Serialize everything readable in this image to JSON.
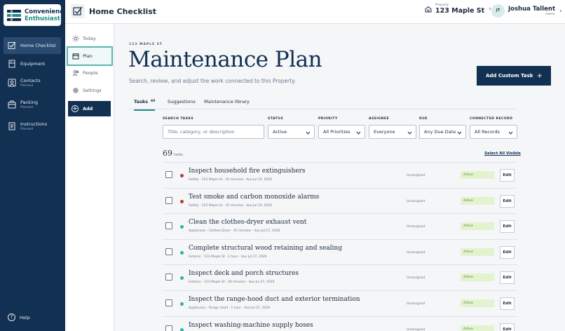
{
  "brand": {
    "line1": "Convenience",
    "line2": "Enthusiast"
  },
  "sidebar": {
    "items": [
      {
        "label": "Home Checklist",
        "sub": ""
      },
      {
        "label": "Equipment",
        "sub": ""
      },
      {
        "label": "Contacts",
        "sub": "Planned"
      },
      {
        "label": "Packing",
        "sub": "Planned"
      },
      {
        "label": "Instructions",
        "sub": "Planned"
      }
    ],
    "help": "Help"
  },
  "topbar": {
    "title": "Home Checklist",
    "property_label": "Property",
    "property_name": "123 Maple St",
    "user_initials": "JT",
    "user_name": "Joshua Tallent",
    "user_role": "owner"
  },
  "nav2": {
    "items": [
      "Today",
      "Plan",
      "People",
      "Settings"
    ],
    "add": "Add"
  },
  "page": {
    "eyebrow": "123 MAPLE ST",
    "title": "Maintenance Plan",
    "subtitle": "Search, review, and adjust the work connected to this Property.",
    "add_custom": "Add Custom Task",
    "add_plus": "+"
  },
  "tabs": [
    {
      "label": "Tasks",
      "count": "69"
    },
    {
      "label": "Suggestions",
      "count": ""
    },
    {
      "label": "Maintenance library",
      "count": ""
    }
  ],
  "filters": {
    "search_label": "SEARCH TASKS",
    "search_placeholder": "Title, category, or description",
    "status_label": "STATUS",
    "status_value": "Active",
    "priority_label": "PRIORITY",
    "priority_value": "All Priorities",
    "assignee_label": "ASSIGNEE",
    "assignee_value": "Everyone",
    "due_label": "DUE",
    "due_value": "Any Due Date",
    "connected_label": "CONNECTED RECORD",
    "connected_value": "All Records"
  },
  "list": {
    "count": "69",
    "count_unit": "tasks",
    "select_all": "Select All Visible",
    "tasks": [
      {
        "title": "Inspect household fire extinguishers",
        "meta": "Safety · 123 Maple St · 10 minutes · due Jul 20, 2026",
        "assignee": "Unassigned",
        "status": "Active",
        "edit": "Edit",
        "priority_color": "#c0392b"
      },
      {
        "title": "Test smoke and carbon monoxide alarms",
        "meta": "Safety · 123 Maple St · 15 minutes · due Jul 20, 2026",
        "assignee": "Unassigned",
        "status": "Active",
        "edit": "Edit",
        "priority_color": "#c0392b"
      },
      {
        "title": "Clean the clothes-dryer exhaust vent",
        "meta": "Appliances · Clothes Dryer · 45 minutes · due Jul 27, 2026",
        "assignee": "Unassigned",
        "status": "Active",
        "edit": "Edit",
        "priority_color": "#2bb3a3"
      },
      {
        "title": "Complete structural wood retaining and sealing",
        "meta": "Exterior · 123 Maple St · 1 hour · due Jul 27, 2026",
        "assignee": "Unassigned",
        "status": "Active",
        "edit": "Edit",
        "priority_color": "#2bb3a3"
      },
      {
        "title": "Inspect deck and porch structures",
        "meta": "Exterior · 123 Maple St · 30 minutes · due Jul 27, 2026",
        "assignee": "Unassigned",
        "status": "Active",
        "edit": "Edit",
        "priority_color": "#2bb3a3"
      },
      {
        "title": "Inspect the range-hood duct and exterior termination",
        "meta": "Appliances · Range Hood · 1 hour · due Jul 27, 2026",
        "assignee": "Unassigned",
        "status": "Active",
        "edit": "Edit",
        "priority_color": "#2bb3a3"
      },
      {
        "title": "Inspect washing-machine supply hoses",
        "meta": "",
        "assignee": "Unassigned",
        "status": "Active",
        "edit": "Edit",
        "priority_color": "#2bb3a3"
      }
    ]
  }
}
